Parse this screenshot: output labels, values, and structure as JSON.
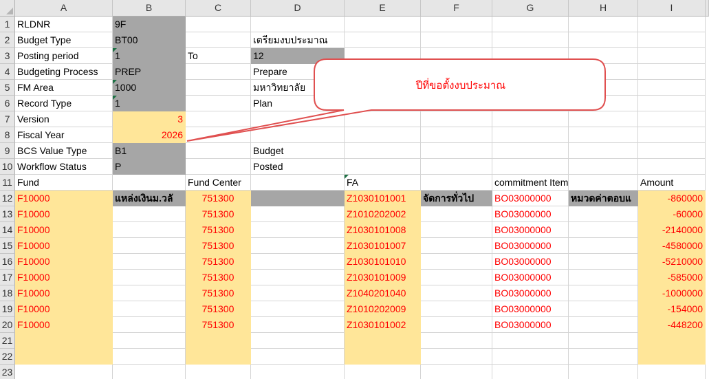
{
  "column_headers": [
    "A",
    "B",
    "C",
    "D",
    "E",
    "F",
    "G",
    "H",
    "I"
  ],
  "rows": [
    {
      "num": "1",
      "A": "RLDNR",
      "B": "9F"
    },
    {
      "num": "2",
      "A": "Budget Type",
      "B": "BT00",
      "D": "เตรียมงบประมาณ"
    },
    {
      "num": "3",
      "A": "Posting period",
      "B": "1",
      "C": "To",
      "D": "12"
    },
    {
      "num": "4",
      "A": "Budgeting Process",
      "B": "PREP",
      "D": "Prepare"
    },
    {
      "num": "5",
      "A": "FM Area",
      "B": "1000",
      "D": "มหาวิทยาลัย"
    },
    {
      "num": "6",
      "A": "Record Type",
      "B": "1",
      "D": "Plan"
    },
    {
      "num": "7",
      "A": "Version",
      "B": "3"
    },
    {
      "num": "8",
      "A": "Fiscal Year",
      "B": "2026"
    },
    {
      "num": "9",
      "A": "BCS Value Type",
      "B": "B1",
      "D": "Budget"
    },
    {
      "num": "10",
      "A": "Workflow Status",
      "B": "P",
      "D": "Posted"
    },
    {
      "num": "11",
      "A": "Fund",
      "C": "Fund Center",
      "E": "FA",
      "G": "commitment Item",
      "I": "Amount"
    },
    {
      "num": "12",
      "A": "F10000",
      "B": "แหล่งเงินม.วลั",
      "C": "751300",
      "E": "Z1030101001",
      "F": "จัดการทั่วไป",
      "G": "BO03000000",
      "H": "หมวดค่าตอบแ",
      "I": "-860000"
    },
    {
      "num": "13",
      "A": "F10000",
      "C": "751300",
      "E": "Z1010202002",
      "G": "BO03000000",
      "I": "-60000"
    },
    {
      "num": "14",
      "A": "F10000",
      "C": "751300",
      "E": "Z1030101008",
      "G": "BO03000000",
      "I": "-2140000"
    },
    {
      "num": "15",
      "A": "F10000",
      "C": "751300",
      "E": "Z1030101007",
      "G": "BO03000000",
      "I": "-4580000"
    },
    {
      "num": "16",
      "A": "F10000",
      "C": "751300",
      "E": "Z1030101010",
      "G": "BO03000000",
      "I": "-5210000"
    },
    {
      "num": "17",
      "A": "F10000",
      "C": "751300",
      "E": "Z1030101009",
      "G": "BO03000000",
      "I": "-585000"
    },
    {
      "num": "18",
      "A": "F10000",
      "C": "751300",
      "E": "Z1040201040",
      "G": "BO03000000",
      "I": "-1000000"
    },
    {
      "num": "19",
      "A": "F10000",
      "C": "751300",
      "E": "Z1010202009",
      "G": "BO03000000",
      "I": "-154000"
    },
    {
      "num": "20",
      "A": "F10000",
      "C": "751300",
      "E": "Z1030101002",
      "G": "BO03000000",
      "I": "-448200"
    },
    {
      "num": "21"
    },
    {
      "num": "22"
    },
    {
      "num": "23"
    }
  ],
  "callout": {
    "text": "ปีที่ขอตั้งงบประมาณ",
    "color": "#ff0000"
  },
  "colors": {
    "header_gray": "#e6e6e6",
    "fill_gray": "#a6a6a6",
    "fill_yellow": "#ffe699",
    "text_red": "#ff0000",
    "comment_marker": "#1e7145"
  }
}
